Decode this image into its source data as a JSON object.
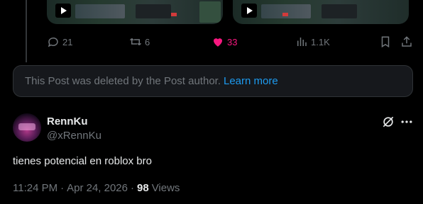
{
  "post_actions": {
    "replies": "21",
    "reposts": "6",
    "likes": "33",
    "views": "1.1K"
  },
  "deleted_notice": {
    "text": "This Post was deleted by the Post author.",
    "link": "Learn more"
  },
  "reply": {
    "display_name": "RennKu",
    "handle": "@xRennKu",
    "text": "tienes potencial en roblox bro",
    "time": "11:24 PM",
    "separator": "·",
    "date": "Apr 24, 2026",
    "views_count": "98",
    "views_label": "Views"
  },
  "colors": {
    "background": "#000000",
    "muted": "#71767b",
    "accent": "#1d9bf0",
    "like": "#f91880"
  },
  "icons": {
    "reply": "reply-icon",
    "repost": "repost-icon",
    "like": "heart-filled-icon",
    "views": "analytics-icon",
    "bookmark": "bookmark-icon",
    "share": "share-icon",
    "grok": "grok-icon",
    "more": "more-icon",
    "play": "play-icon"
  }
}
